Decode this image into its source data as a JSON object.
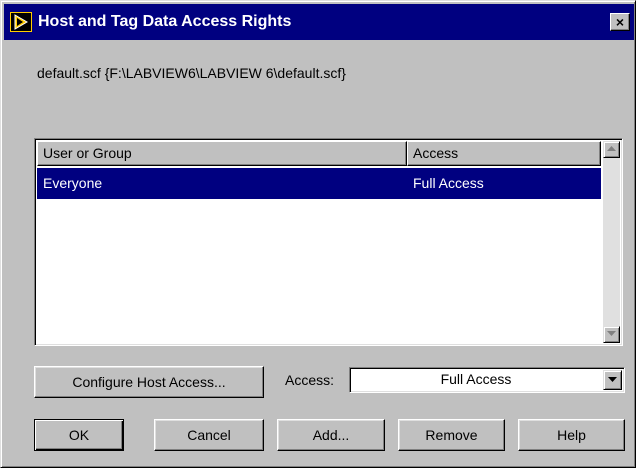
{
  "window": {
    "title": "Host and Tag Data Access Rights",
    "close_label": "×"
  },
  "file": {
    "path": "default.scf {F:\\LABVIEW6\\LABVIEW 6\\default.scf}"
  },
  "list": {
    "columns": [
      "User or Group",
      "Access"
    ],
    "rows": [
      {
        "user": "Everyone",
        "access": "Full Access",
        "selected": true
      }
    ]
  },
  "controls": {
    "configure_host_access_label": "Configure Host Access...",
    "access_label": "Access:",
    "access_value": "Full Access"
  },
  "buttons": {
    "ok": "OK",
    "cancel": "Cancel",
    "add": "Add...",
    "remove": "Remove",
    "help": "Help"
  },
  "icons": {
    "app": "labview-run-icon",
    "close": "close-icon",
    "scroll_up": "arrow-up-icon",
    "scroll_down": "arrow-down-icon",
    "dropdown": "chevron-down-icon"
  },
  "colors": {
    "titlebar": "#000080",
    "selection": "#000080",
    "face": "#c0c0c0"
  }
}
